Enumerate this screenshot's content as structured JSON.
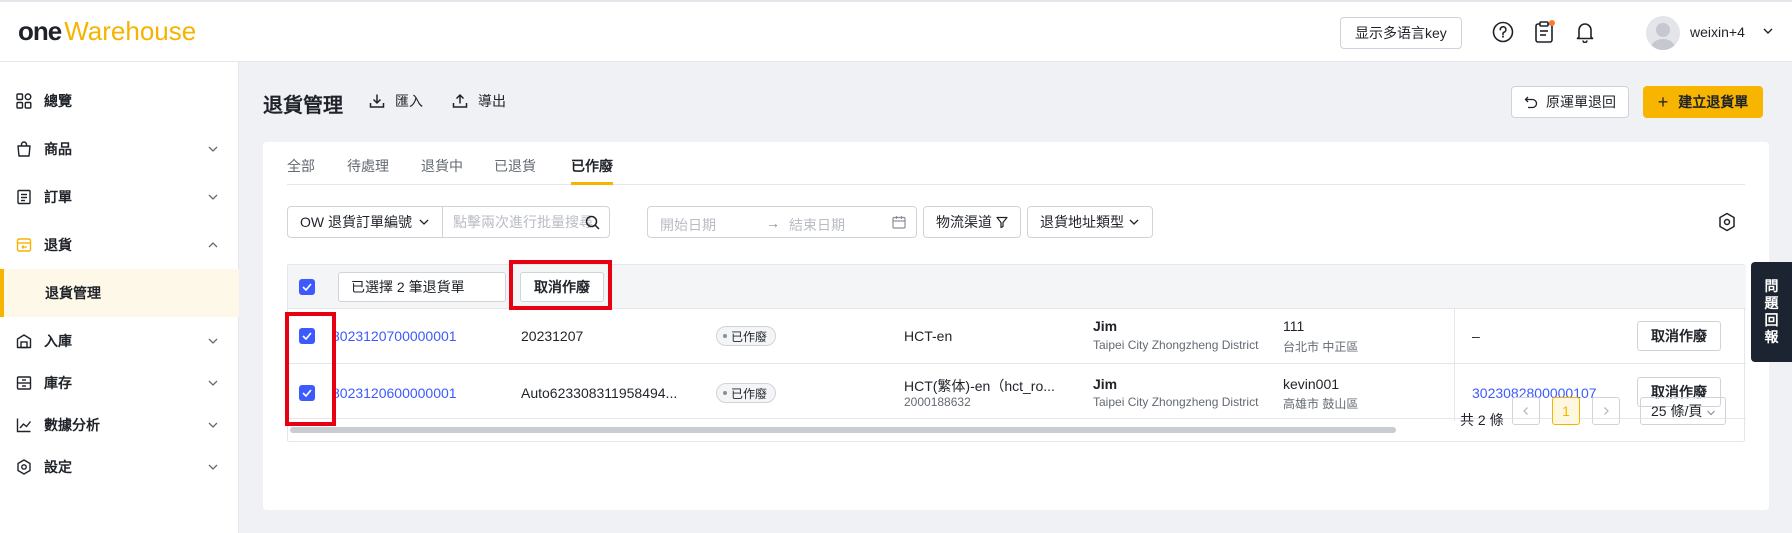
{
  "brand": {
    "part1": "one",
    "part2": "Warehouse"
  },
  "topbar": {
    "lang_button": "显示多语言key",
    "username": "weixin+4"
  },
  "sidebar": {
    "items": [
      {
        "label": "總覽",
        "icon": "dashboard-icon"
      },
      {
        "label": "商品",
        "icon": "product-icon"
      },
      {
        "label": "訂單",
        "icon": "order-icon"
      },
      {
        "label": "退貨",
        "icon": "return-icon"
      },
      {
        "label": "入庫",
        "icon": "inbound-icon"
      },
      {
        "label": "庫存",
        "icon": "inventory-icon"
      },
      {
        "label": "數據分析",
        "icon": "analytics-icon"
      },
      {
        "label": "設定",
        "icon": "settings-icon"
      }
    ],
    "sub_active": "退貨管理"
  },
  "header": {
    "title": "退貨管理",
    "import_label": "匯入",
    "export_label": "導出",
    "return_button": "原運單退回",
    "create_button": "建立退貨單"
  },
  "tabs": [
    "全部",
    "待處理",
    "退貨中",
    "已退貨",
    "已作廢"
  ],
  "active_tab": "已作廢",
  "filters": {
    "field_select": "OW 退貨訂單編號",
    "search_placeholder": "點擊兩次進行批量搜尋",
    "date_start": "開始日期",
    "date_end": "結束日期",
    "logistics": "物流渠道",
    "address_type": "退貨地址類型"
  },
  "bulk": {
    "selected_text": "已選擇 2 筆退貨單",
    "cancel_label": "取消作廢"
  },
  "rows": [
    {
      "order_no": "8023120700000001",
      "ref": "20231207",
      "status": "已作廢",
      "carrier": "HCT-en",
      "carrier_sub": "",
      "sender": "Jim",
      "sender_addr": "Taipei City Zhongzheng District",
      "receiver": "111",
      "receiver_addr": "台北市 中正區",
      "related": "–",
      "action": "取消作廢"
    },
    {
      "order_no": "8023120600000001",
      "ref": "Auto623308311958494...",
      "status": "已作廢",
      "carrier": "HCT(繁体)-en（hct_ro...",
      "carrier_sub": "2000188632",
      "sender": "Jim",
      "sender_addr": "Taipei City Zhongzheng District",
      "receiver": "kevin001",
      "receiver_addr": "高雄市 鼓山區",
      "related": "3023082800000107",
      "action": "取消作廢"
    }
  ],
  "pagination": {
    "total": "共 2 條",
    "current": "1",
    "page_size": "25 條/頁"
  },
  "feedback": [
    "問",
    "題",
    "回",
    "報"
  ],
  "colors": {
    "accent": "#f5b400",
    "link": "#3d5afe",
    "annotation": "#e60012"
  }
}
